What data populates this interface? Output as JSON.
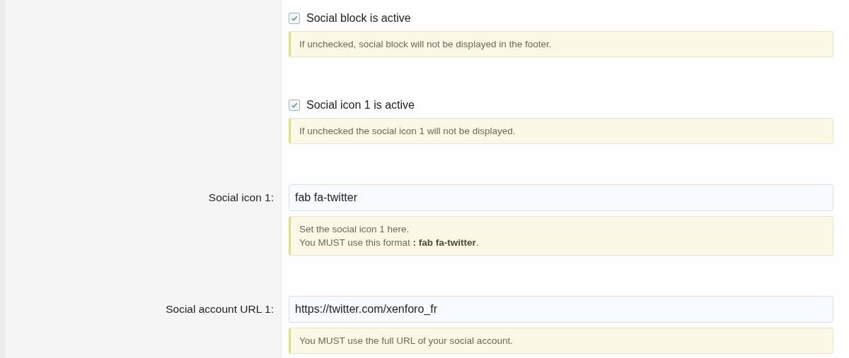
{
  "rows": [
    {
      "kind": "checkbox",
      "label": "Social block is active",
      "checked": true,
      "hint": [
        "If unchecked, social block will not be displayed in the footer."
      ]
    },
    {
      "kind": "checkbox",
      "label": "Social icon 1 is active",
      "checked": true,
      "hint": [
        "If unchecked the social icon 1 will not be displayed."
      ]
    },
    {
      "kind": "text",
      "label": "Social icon 1:",
      "value": "fab fa-twitter",
      "hint": [
        "Set the social icon 1 here.",
        "You MUST use this format **: fab fa-twitter**."
      ]
    },
    {
      "kind": "text",
      "label": "Social account URL 1:",
      "value": "https://twitter.com/xenforo_fr",
      "hint": [
        "You MUST use the full URL of your social account."
      ]
    }
  ]
}
